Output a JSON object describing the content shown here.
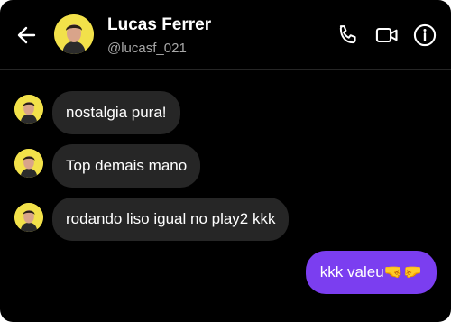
{
  "header": {
    "name": "Lucas Ferrer",
    "handle": "@lucasf_021",
    "back_icon": "arrow-left-icon",
    "actions": [
      "phone-icon",
      "video-camera-icon",
      "info-icon"
    ]
  },
  "messages": {
    "incoming": [
      {
        "text": "nostalgia pura!"
      },
      {
        "text": "Top demais mano"
      },
      {
        "text": "rodando liso igual no play2 kkk"
      }
    ],
    "outgoing": [
      {
        "text": "kkk valeu🤜🤛"
      }
    ]
  },
  "colors": {
    "background": "#000000",
    "incoming_bubble": "#262626",
    "outgoing_bubble": "#7b3ef0",
    "avatar_bg": "#f2e14a",
    "secondary_text": "#a8a8a8"
  }
}
